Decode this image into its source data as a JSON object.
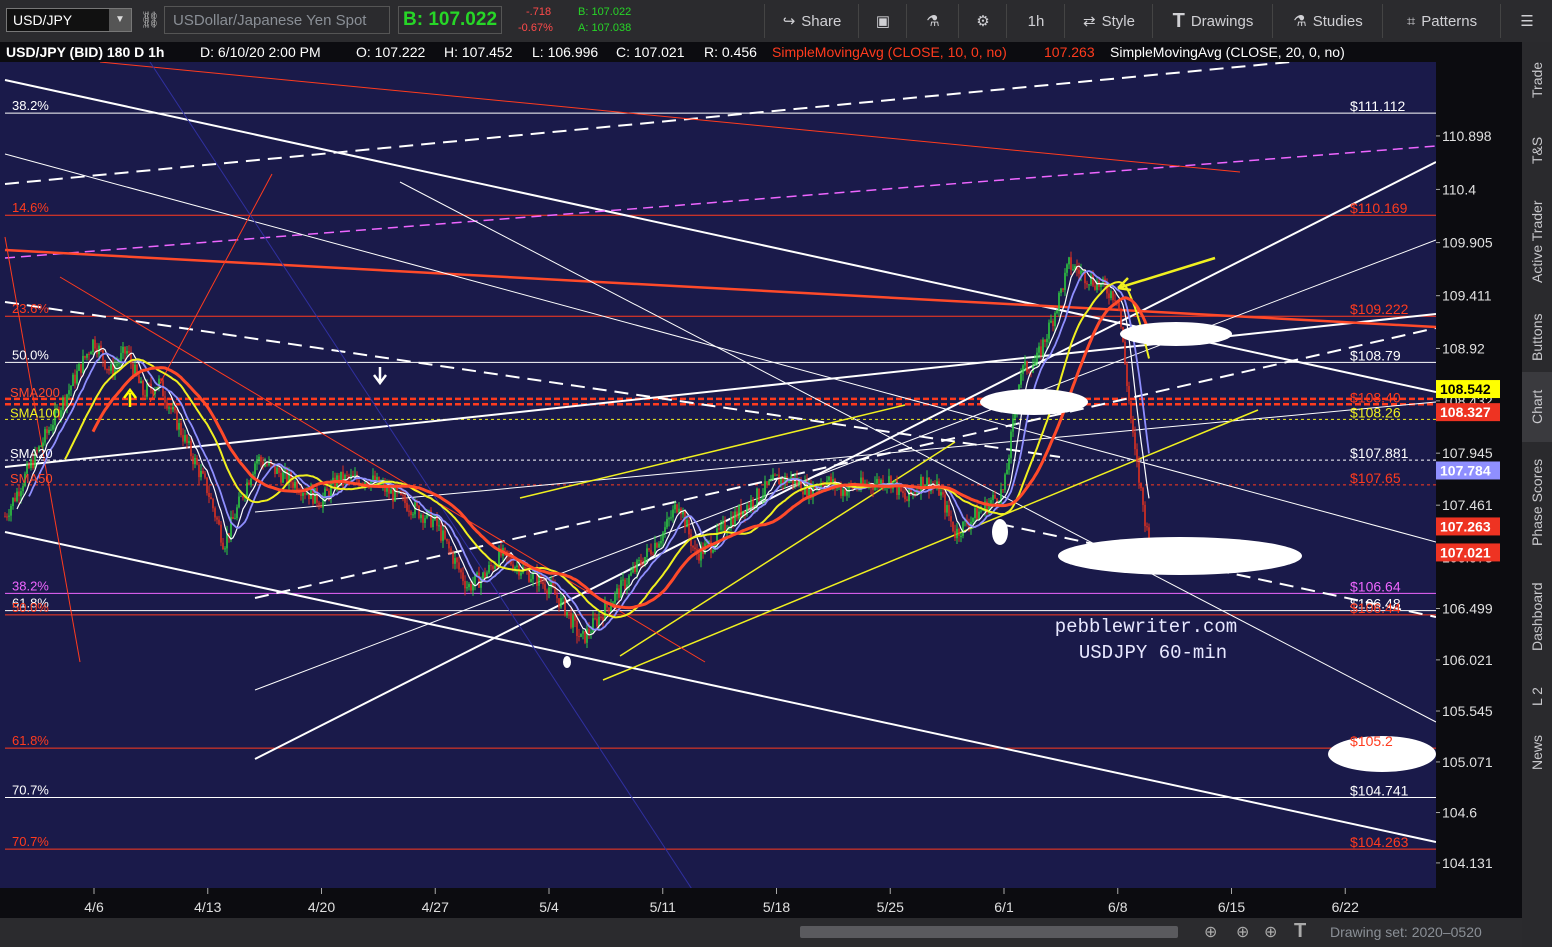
{
  "toolbar": {
    "symbol": "USD/JPY",
    "description": "USDollar/Japanese Yen Spot",
    "bid_label": "B: 107.022",
    "change": "-.718",
    "change_pct": "-0.67%",
    "bid_small": "B: 107.022",
    "ask_small": "A: 107.038",
    "share": "Share",
    "timeframe": "1h",
    "style": "Style",
    "drawings": "Drawings",
    "studies": "Studies",
    "patterns": "Patterns"
  },
  "legend": {
    "symbol_info": "USD/JPY (BID) 180 D 1h",
    "date": "D: 6/10/20 2:00 PM",
    "open": "O: 107.222",
    "high": "H: 107.452",
    "low": "L: 106.996",
    "close": "C: 107.021",
    "range": "R: 0.456",
    "sma10": "SimpleMovingAvg (CLOSE, 10, 0, no)",
    "sma10_val": "107.263",
    "sma20": "SimpleMovingAvg (CLOSE, 20, 0, no)"
  },
  "right_tabs": [
    "Trade",
    "T&S",
    "Active Trader",
    "Buttons",
    "Chart",
    "Phase Scores",
    "Dashboard",
    "L 2",
    "News"
  ],
  "bottom": {
    "drawing_set": "Drawing set: 2020–0520"
  },
  "watermark": {
    "line1": "pebblewriter.com",
    "line2": "USDJPY 60-min"
  },
  "colors": {
    "background": "#1a1a4a",
    "bull": "#2ecc40",
    "bear": "#e03020",
    "sma10": "#ffffff",
    "sma20": "#8f8fff",
    "sma50": "#ff4a2a",
    "sma100": "#f0f020",
    "fib_red": "#ff3b1e",
    "fib_white": "#ffffff",
    "fib_magenta": "#ee66ff"
  },
  "chart_data": {
    "type": "candlestick",
    "title": "USD/JPY (BID) 180 D 1h",
    "x_tick_labels": [
      "4/6",
      "4/13",
      "4/20",
      "4/27",
      "5/4",
      "5/11",
      "5/18",
      "5/25",
      "6/1",
      "6/8",
      "6/15",
      "6/22"
    ],
    "y_tick_labels": [
      "110.898",
      "110.4",
      "109.905",
      "109.411",
      "108.92",
      "108.432",
      "107.945",
      "107.461",
      "106.973",
      "106.499",
      "106.021",
      "105.545",
      "105.071",
      "104.6",
      "104.131"
    ],
    "ylim": [
      104.0,
      111.4
    ],
    "last_price": 107.021,
    "path": [
      [
        "3/30",
        107.5
      ],
      [
        "3/31",
        107.2
      ],
      [
        "4/2",
        107.8
      ],
      [
        "4/6",
        109.0
      ],
      [
        "4/7",
        108.7
      ],
      [
        "4/8",
        108.9
      ],
      [
        "4/9",
        108.5
      ],
      [
        "4/10",
        108.6
      ],
      [
        "4/13",
        107.6
      ],
      [
        "4/14",
        107.1
      ],
      [
        "4/15",
        107.5
      ],
      [
        "4/16",
        107.9
      ],
      [
        "4/20",
        107.5
      ],
      [
        "4/21",
        107.7
      ],
      [
        "4/23",
        107.7
      ],
      [
        "4/24",
        107.6
      ],
      [
        "4/27",
        107.3
      ],
      [
        "4/29",
        106.7
      ],
      [
        "4/30",
        106.8
      ],
      [
        "5/1",
        107.0
      ],
      [
        "5/4",
        106.7
      ],
      [
        "5/5",
        106.5
      ],
      [
        "5/6",
        106.2
      ],
      [
        "5/7",
        106.4
      ],
      [
        "5/8",
        106.6
      ],
      [
        "5/11",
        107.2
      ],
      [
        "5/12",
        107.5
      ],
      [
        "5/13",
        107.0
      ],
      [
        "5/14",
        107.1
      ],
      [
        "5/15",
        107.3
      ],
      [
        "5/18",
        107.7
      ],
      [
        "5/19",
        107.7
      ],
      [
        "5/20",
        107.6
      ],
      [
        "5/21",
        107.7
      ],
      [
        "5/22",
        107.6
      ],
      [
        "5/25",
        107.7
      ],
      [
        "5/26",
        107.5
      ],
      [
        "5/27",
        107.7
      ],
      [
        "5/28",
        107.6
      ],
      [
        "5/29",
        107.2
      ],
      [
        "6/1",
        107.6
      ],
      [
        "6/2",
        108.7
      ],
      [
        "6/3",
        108.8
      ],
      [
        "6/4",
        109.2
      ],
      [
        "6/5",
        109.7
      ],
      [
        "6/8",
        109.4
      ],
      [
        "6/9",
        108.0
      ],
      [
        "6/10",
        107.021
      ]
    ],
    "moving_averages": [
      {
        "name": "SMA20",
        "color": "#8f8fff"
      },
      {
        "name": "SMA50",
        "color": "#ff4a2a"
      },
      {
        "name": "SMA100",
        "color": "#f0f020"
      },
      {
        "name": "SMA200",
        "color": "#ff4a2a"
      }
    ],
    "fib_labels_left": [
      {
        "label": "38.2%",
        "y": 111.11,
        "color": "#ffffff"
      },
      {
        "label": "14.6%",
        "y": 110.16,
        "color": "#ff3b1e"
      },
      {
        "label": "23.6%",
        "y": 109.22,
        "color": "#ff3b1e"
      },
      {
        "label": "50.0%",
        "y": 108.79,
        "color": "#ffffff"
      },
      {
        "label": "38.2%",
        "y": 106.64,
        "color": "#ee66ff"
      },
      {
        "label": "61.8%",
        "y": 106.48,
        "color": "#ffffff"
      },
      {
        "label": "50.0%",
        "y": 106.44,
        "color": "#ff3b1e"
      },
      {
        "label": "61.8%",
        "y": 105.2,
        "color": "#ff3b1e"
      },
      {
        "label": "70.7%",
        "y": 104.74,
        "color": "#ffffff"
      },
      {
        "label": "70.7%",
        "y": 104.26,
        "color": "#ff3b1e"
      }
    ],
    "ma_labels_left": [
      {
        "label": "SMA200",
        "y": 108.45,
        "color": "#ff4a2a"
      },
      {
        "label": "SMA100",
        "y": 108.26,
        "color": "#f0f020"
      },
      {
        "label": "SMA20",
        "y": 107.88,
        "color": "#ffffff"
      },
      {
        "label": "SMA50",
        "y": 107.65,
        "color": "#ff4a2a"
      }
    ],
    "level_labels": [
      {
        "label": "$111.112",
        "y": 111.11,
        "color": "#ffffff"
      },
      {
        "label": "$110.169",
        "y": 110.16,
        "color": "#ff3b1e"
      },
      {
        "label": "$109.222",
        "y": 109.22,
        "color": "#ff3b1e"
      },
      {
        "label": "$108.79",
        "y": 108.79,
        "color": "#ffffff"
      },
      {
        "label": "$108.40",
        "y": 108.4,
        "color": "#ff3b1e"
      },
      {
        "label": "$108.26",
        "y": 108.26,
        "color": "#f0f020"
      },
      {
        "label": "$107.881",
        "y": 107.88,
        "color": "#ffffff"
      },
      {
        "label": "$107.65",
        "y": 107.65,
        "color": "#ff3b1e"
      },
      {
        "label": "$106.64",
        "y": 106.64,
        "color": "#ee66ff"
      },
      {
        "label": "$106.48",
        "y": 106.48,
        "color": "#ffffff"
      },
      {
        "label": "$106.44",
        "y": 106.44,
        "color": "#ff3b1e"
      },
      {
        "label": "$105.2",
        "y": 105.2,
        "color": "#ff3b1e"
      },
      {
        "label": "$104.741",
        "y": 104.74,
        "color": "#ffffff"
      },
      {
        "label": "$104.263",
        "y": 104.26,
        "color": "#ff3b1e"
      }
    ],
    "price_badges": [
      {
        "label": "108.542",
        "y": 108.542,
        "bg": "#ffff00",
        "fg": "#000000"
      },
      {
        "label": "108.327",
        "y": 108.327,
        "bg": "#ee3322",
        "fg": "#ffffff"
      },
      {
        "label": "107.784",
        "y": 107.784,
        "bg": "#8f8fff",
        "fg": "#ffffff"
      },
      {
        "label": "107.263",
        "y": 107.263,
        "bg": "#ee3322",
        "fg": "#ffffff"
      },
      {
        "label": "107.021",
        "y": 107.021,
        "bg": "#ee3322",
        "fg": "#ffffff"
      }
    ]
  }
}
